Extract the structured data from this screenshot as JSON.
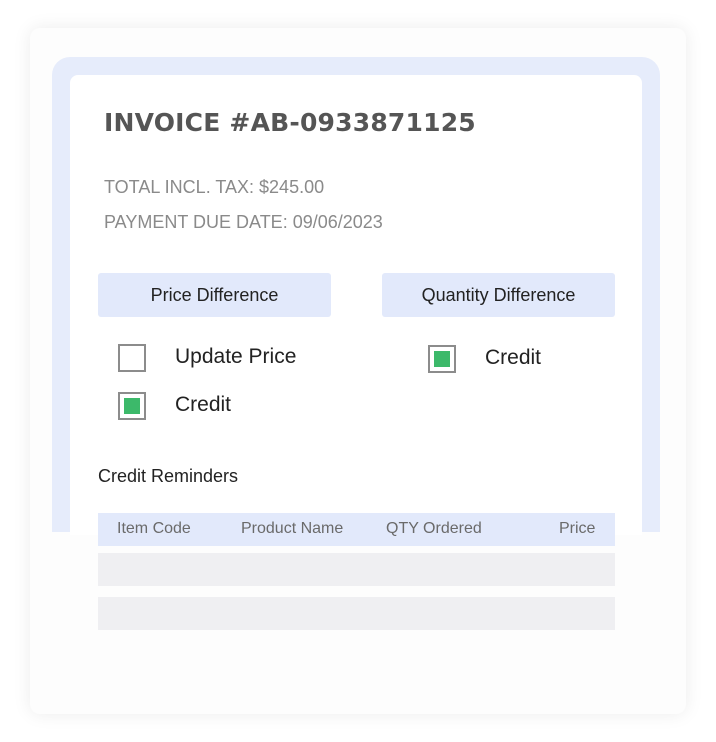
{
  "invoice": {
    "title": "INVOICE #AB-0933871125",
    "total_incl_tax": "TOTAL INCL. TAX: $245.00",
    "payment_due_date": "PAYMENT DUE DATE: 09/06/2023"
  },
  "price_difference": {
    "header": "Price Difference",
    "options": [
      {
        "label": "Update Price",
        "checked": false
      },
      {
        "label": "Credit",
        "checked": true
      }
    ]
  },
  "quantity_difference": {
    "header": "Quantity Difference",
    "options": [
      {
        "label": "Credit",
        "checked": true
      }
    ]
  },
  "credit_reminders": {
    "title": "Credit Reminders",
    "columns": [
      "Item Code",
      "Product Name",
      "QTY Ordered",
      "Price"
    ],
    "rows": [
      [],
      []
    ]
  },
  "colors": {
    "frame": "#e6ecfb",
    "header_bg": "#e2e9fb",
    "checked_fill": "#3cb96a",
    "row_bg": "#efeff2"
  }
}
